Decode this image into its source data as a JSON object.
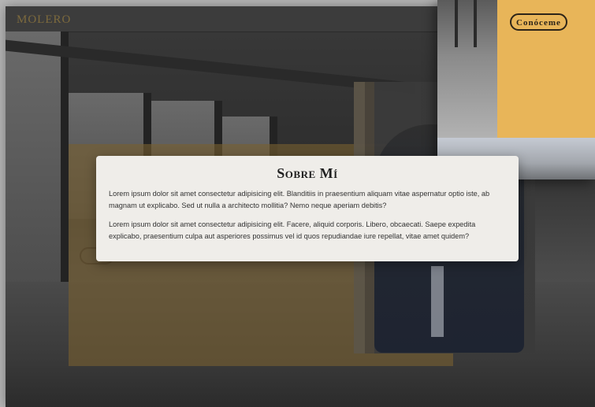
{
  "header": {
    "logo_text": "MOLERO"
  },
  "hero": {
    "subtitle": "",
    "title": "",
    "button_label": ""
  },
  "inset": {
    "button_label": "Conóceme"
  },
  "modal": {
    "title": "Sobre Mí",
    "paragraphs": [
      "Lorem ipsum dolor sit amet consectetur adipisicing elit. Blanditiis in praesentium aliquam vitae aspernatur optio iste, ab magnam ut explicabo. Sed ut nulla a architecto mollitia? Nemo neque aperiam debitis?",
      "Lorem ipsum dolor sit amet consectetur adipisicing elit. Facere, aliquid corporis. Libero, obcaecati. Saepe expedita explicabo, praesentium culpa aut asperiores possimus vel id quos repudiandae iure repellat, vitae amet quidem?"
    ]
  },
  "colors": {
    "accent_gold": "#e8b559",
    "modal_bg": "#efede9",
    "text_dark": "#1f1f1f"
  }
}
